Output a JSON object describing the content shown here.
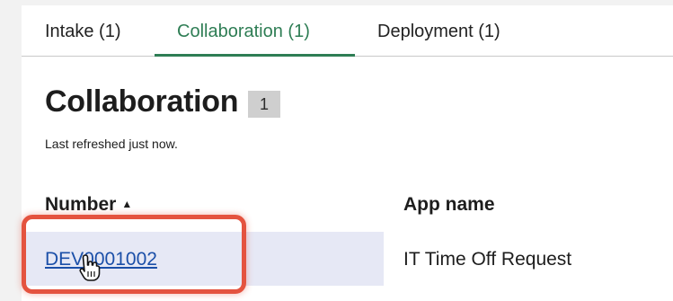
{
  "tabs": [
    {
      "label": "Intake (1)",
      "active": false
    },
    {
      "label": "Collaboration (1)",
      "active": true
    },
    {
      "label": "Deployment (1)",
      "active": false
    }
  ],
  "section": {
    "title": "Collaboration",
    "count": "1",
    "refreshed": "Last refreshed just now."
  },
  "table": {
    "columns": [
      {
        "label": "Number",
        "sort": "ascending",
        "sort_icon": "sort-up-arrow"
      },
      {
        "label": "App name"
      }
    ],
    "rows": [
      {
        "number": "DEV0001002",
        "app_name": "IT Time Off Request"
      }
    ]
  },
  "colors": {
    "accent": "#2e7d54",
    "link": "#1b4fa8",
    "highlight": "#e4533f",
    "selected_row": "#e6e8f5"
  },
  "cursor": {
    "icon": "hand-pointer-icon"
  }
}
